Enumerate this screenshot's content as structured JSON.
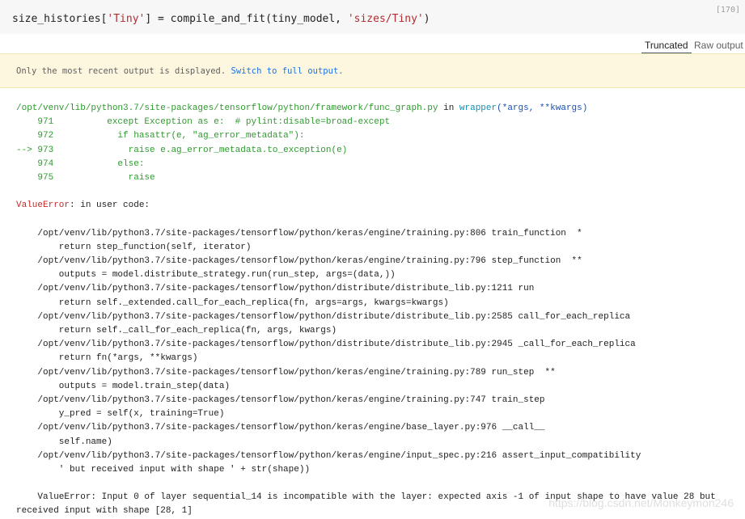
{
  "cell": {
    "exec_count": "[170]",
    "code_pre": "size_histories[",
    "code_s1": "'Tiny'",
    "code_mid": "] = compile_and_fit(tiny_model, ",
    "code_s2": "'sizes/Tiny'",
    "code_post": ")"
  },
  "tabs": {
    "truncated": "Truncated",
    "raw": "Raw output"
  },
  "notice": {
    "text": "Only the most recent output is displayed. ",
    "link": "Switch to full output."
  },
  "traceback": {
    "header_path": "/opt/venv/lib/python3.7/site-packages/tensorflow/python/framework/func_graph.py",
    "header_in": " in ",
    "header_func": "wrapper",
    "header_args": "(*args, **kwargs)",
    "context_lines": [
      {
        "arrow": "    ",
        "num": "971",
        "body": "          except Exception as e:  # pylint:disable=broad-except"
      },
      {
        "arrow": "    ",
        "num": "972",
        "body": "            if hasattr(e, \"ag_error_metadata\"):"
      },
      {
        "arrow": "--> ",
        "num": "973",
        "body": "              raise e.ag_error_metadata.to_exception(e)"
      },
      {
        "arrow": "    ",
        "num": "974",
        "body": "            else:"
      },
      {
        "arrow": "    ",
        "num": "975",
        "body": "              raise"
      }
    ],
    "error_type": "ValueError",
    "error_msg": ": in user code:",
    "frames": [
      {
        "loc": "    /opt/venv/lib/python3.7/site-packages/tensorflow/python/keras/engine/training.py:806 train_function  *",
        "code": "        return step_function(self, iterator)"
      },
      {
        "loc": "    /opt/venv/lib/python3.7/site-packages/tensorflow/python/keras/engine/training.py:796 step_function  **",
        "code": "        outputs = model.distribute_strategy.run(run_step, args=(data,))"
      },
      {
        "loc": "    /opt/venv/lib/python3.7/site-packages/tensorflow/python/distribute/distribute_lib.py:1211 run",
        "code": "        return self._extended.call_for_each_replica(fn, args=args, kwargs=kwargs)"
      },
      {
        "loc": "    /opt/venv/lib/python3.7/site-packages/tensorflow/python/distribute/distribute_lib.py:2585 call_for_each_replica",
        "code": "        return self._call_for_each_replica(fn, args, kwargs)"
      },
      {
        "loc": "    /opt/venv/lib/python3.7/site-packages/tensorflow/python/distribute/distribute_lib.py:2945 _call_for_each_replica",
        "code": "        return fn(*args, **kwargs)"
      },
      {
        "loc": "    /opt/venv/lib/python3.7/site-packages/tensorflow/python/keras/engine/training.py:789 run_step  **",
        "code": "        outputs = model.train_step(data)"
      },
      {
        "loc": "    /opt/venv/lib/python3.7/site-packages/tensorflow/python/keras/engine/training.py:747 train_step",
        "code": "        y_pred = self(x, training=True)"
      },
      {
        "loc": "    /opt/venv/lib/python3.7/site-packages/tensorflow/python/keras/engine/base_layer.py:976 __call__",
        "code": "        self.name)"
      },
      {
        "loc": "    /opt/venv/lib/python3.7/site-packages/tensorflow/python/keras/engine/input_spec.py:216 assert_input_compatibility",
        "code": "        ' but received input with shape ' + str(shape))"
      }
    ],
    "final_error": "    ValueError: Input 0 of layer sequential_14 is incompatible with the layer: expected axis -1 of input shape to have value 28 but received input with shape [28, 1]"
  },
  "watermark": "https://blog.csdn.net/Monkeymon246"
}
